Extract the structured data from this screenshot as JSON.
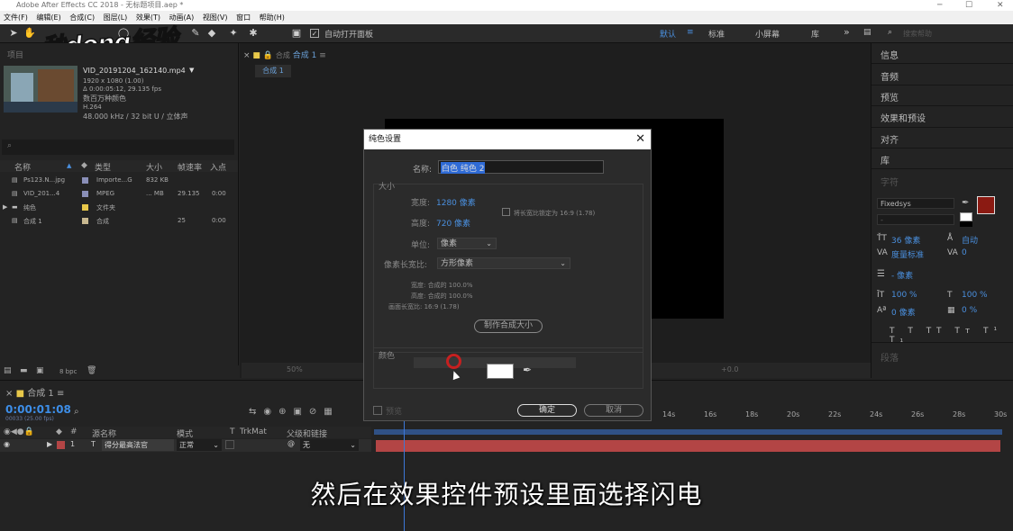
{
  "window": {
    "title": "Adobe After Effects CC 2018 - 无标题项目.aep *"
  },
  "menu": [
    "文件(F)",
    "编辑(E)",
    "合成(C)",
    "图层(L)",
    "效果(T)",
    "动画(A)",
    "视图(V)",
    "窗口",
    "帮助(H)"
  ],
  "toolbar": {
    "auto_open_label": "自动打开面板",
    "workspaces": [
      "默认",
      "标准",
      "小屏幕",
      "库"
    ],
    "search_placeholder": "搜索帮助"
  },
  "watermark": "秒dong经验",
  "project": {
    "tab": "项目",
    "file_name": "VID_20191204_162140.mp4",
    "file_meta": [
      "1920 x 1080 (1.00)",
      "Δ 0:00:05:12, 29.135 fps",
      "数百万种颜色",
      "H.264",
      "48.000 kHz / 32 bit U / 立体声"
    ],
    "columns": [
      "名称",
      "类型",
      "大小",
      "帧速率",
      "入点"
    ],
    "rows": [
      {
        "name": "Ps123.N...jpg",
        "type": "Importe...G",
        "size": "832 KB",
        "fps": "",
        "in": "",
        "color": "#8a8fb8"
      },
      {
        "name": "VID_201...4",
        "type": "MPEG",
        "size": "... MB",
        "fps": "29.135",
        "in": "0:00",
        "color": "#8a8fb8"
      },
      {
        "name": "纯色",
        "type": "文件夹",
        "size": "",
        "fps": "",
        "in": "",
        "color": "#e8c84a"
      },
      {
        "name": "合成 1",
        "type": "合成",
        "size": "",
        "fps": "25",
        "in": "0:00",
        "color": "#c8b890"
      }
    ],
    "bpc": "8 bpc"
  },
  "composition": {
    "tab": "合成 1",
    "subtab": "合成 1",
    "zoom": "50%",
    "exposure": "+0.0"
  },
  "right_panel": {
    "items": [
      "信息",
      "音频",
      "预览",
      "效果和预设",
      "对齐",
      "库",
      "字符",
      "段落"
    ],
    "font": "Fixedsys",
    "font_size": "36 像素",
    "leading": "自动",
    "kerning": "度量标准",
    "tracking": "0",
    "stroke": "- 像素",
    "vscale": "100 %",
    "hscale": "100 %",
    "baseline": "0 像素",
    "tsume": "0 %",
    "fill_color": "#8b1a12"
  },
  "timeline": {
    "tab": "合成 1",
    "timecode": "0:00:01:08",
    "subtimecode": "00033 (25.00 fps)",
    "columns": [
      "源名称",
      "模式",
      "T",
      "TrkMat",
      "父级和链接"
    ],
    "layer": {
      "index": "1",
      "name": "得分最高法官",
      "mode": "正常",
      "parent": "无"
    },
    "ruler": [
      "14s",
      "16s",
      "18s",
      "20s",
      "22s",
      "24s",
      "26s",
      "28s",
      "30s"
    ]
  },
  "dialog": {
    "title": "纯色设置",
    "name_label": "名称:",
    "name_value": "白色 纯色 2",
    "size_label": "大小",
    "width_label": "宽度:",
    "width_value": "1280 像素",
    "height_label": "高度:",
    "height_value": "720 像素",
    "lock_label": "将长宽比锁定为 16:9 (1.78)",
    "unit_label": "单位:",
    "unit_value": "像素",
    "par_label": "像素长宽比:",
    "par_value": "方形像素",
    "comp_width": "宽度: 合成的 100.0%",
    "comp_height": "高度: 合成的 100.0%",
    "frame_aspect": "画面长宽比: 16:9 (1.78)",
    "make_comp_size": "制作合成大小",
    "color_label": "颜色",
    "preview_label": "预览",
    "ok": "确定",
    "cancel": "取消",
    "swatch_color": "#ffffff"
  },
  "caption": "然后在效果控件预设里面选择闪电"
}
